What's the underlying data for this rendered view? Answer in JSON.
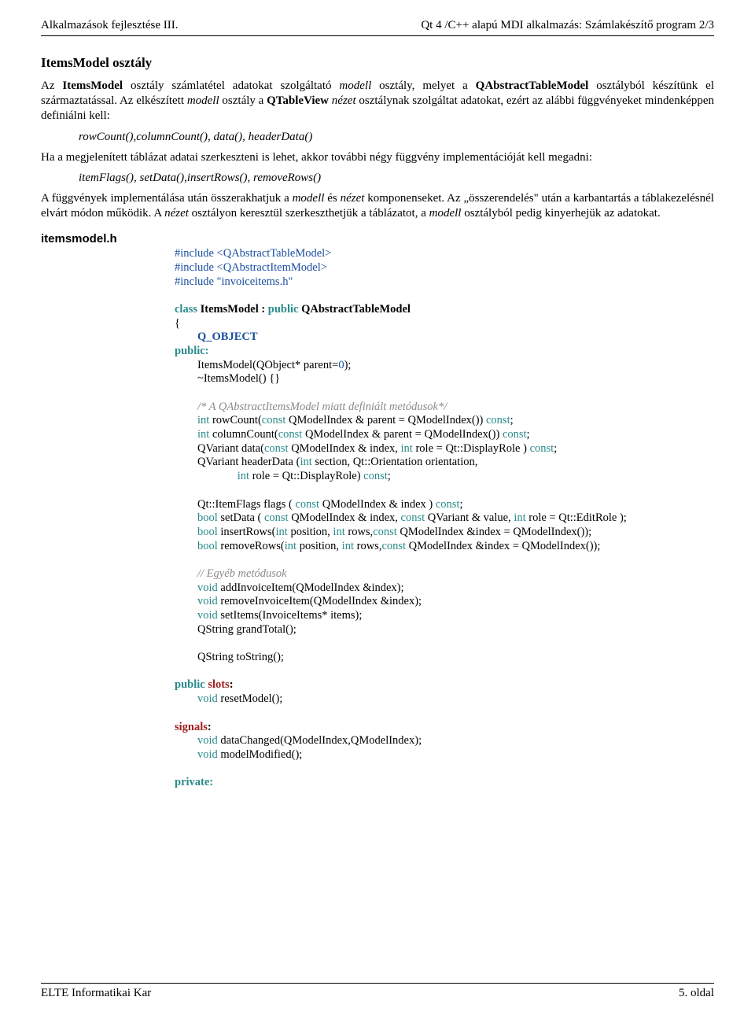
{
  "header": {
    "left": "Alkalmazások fejlesztése III.",
    "right": "Qt 4 /C++ alapú MDI alkalmazás: Számlakészítő program 2/3"
  },
  "section_title": "ItemsModel osztály",
  "para1_a": "Az ",
  "para1_b": "ItemsModel",
  "para1_c": " osztály számlatétel adatokat szolgáltató ",
  "para1_d": "modell",
  "para1_e": " osztály, melyet a ",
  "para1_f": "QAbstractTableModel",
  "para1_g": " osztályból készítünk el származtatással. Az elkészített ",
  "para1_h": "modell",
  "para1_i": " osztály a ",
  "para1_j": "QTableView",
  "para1_k": " ",
  "para1_l": "nézet",
  "para1_m": " osztálynak szolgáltat adatokat, ezért az alábbi függvényeket mindenképpen definiálni kell:",
  "indent1": "rowCount(),columnCount(), data(), headerData()",
  "para2": "Ha a megjelenített táblázat adatai szerkeszteni is lehet, akkor további négy függvény implementációját  kell megadni:",
  "indent2": "itemFlags(), setData(),insertRows(), removeRows()",
  "para3_a": "A függvények implementálása után összerakhatjuk a ",
  "para3_b": "modell",
  "para3_c": " és ",
  "para3_d": "nézet",
  "para3_e": " komponenseket. Az „összerendelés\" után a karbantartás a táblakezelésnél elvárt módon működik. A ",
  "para3_f": "nézet",
  "para3_g": " osztályon keresztül szerkeszthetjük a táblázatot, a ",
  "para3_h": "modell",
  "para3_i": " osztályból pedig kinyerhejük az adatokat.",
  "filename": "itemsmodel.h",
  "code": {
    "l1": "#include <QAbstractTableModel>",
    "l2": "#include <QAbstractItemModel>",
    "l3": "#include \"invoiceitems.h\"",
    "l4a": "class",
    "l4b": " ItemsModel : ",
    "l4c": "public",
    "l4d": " QAbstractTableModel",
    "l5": "{",
    "l6": "Q_OBJECT",
    "l7": "public:",
    "l8a": "ItemsModel(QObject* parent=",
    "l8b": "0",
    "l8c": ");",
    "l9": "~ItemsModel() {}",
    "l10": "/* A QAbstractItemsModel miatt definiált metódusok*/",
    "l11a": "int",
    "l11b": " rowCount(",
    "l11c": "const",
    "l11d": " QModelIndex & parent = QModelIndex()) ",
    "l11e": "const",
    "l11f": ";",
    "l12a": "int",
    "l12b": " columnCount(",
    "l12c": "const",
    "l12d": " QModelIndex & parent = QModelIndex()) ",
    "l12e": "const",
    "l12f": ";",
    "l13a": "QVariant data(",
    "l13b": "const",
    "l13c": " QModelIndex & index, ",
    "l13d": "int",
    "l13e": " role = Qt::DisplayRole ) ",
    "l13f": "const",
    "l13g": ";",
    "l14a": "QVariant headerData (",
    "l14b": "int",
    "l14c": " section, Qt::Orientation orientation,",
    "l15a": "int",
    "l15b": " role = Qt::DisplayRole) ",
    "l15c": "const",
    "l15d": ";",
    "l16a": "Qt::ItemFlags flags ( ",
    "l16b": "const",
    "l16c": " QModelIndex & index ) ",
    "l16d": "const",
    "l16e": ";",
    "l17a": "bool",
    "l17b": " setData ( ",
    "l17c": "const",
    "l17d": " QModelIndex & index, ",
    "l17e": "const",
    "l17f": " QVariant & value, ",
    "l17g": "int",
    "l17h": " role = Qt::EditRole );",
    "l18a": "bool",
    "l18b": " insertRows(",
    "l18c": "int",
    "l18d": " position, ",
    "l18e": "int",
    "l18f": " rows,",
    "l18g": "const",
    "l18h": " QModelIndex &index = QModelIndex());",
    "l19a": "bool",
    "l19b": " removeRows(",
    "l19c": "int",
    "l19d": " position, ",
    "l19e": "int",
    "l19f": " rows,",
    "l19g": "const",
    "l19h": " QModelIndex &index = QModelIndex());",
    "l20": "// Egyéb metódusok",
    "l21a": "void",
    "l21b": " addInvoiceItem(QModelIndex &index);",
    "l22a": "void",
    "l22b": " removeInvoiceItem(QModelIndex &index);",
    "l23a": "void",
    "l23b": " setItems(InvoiceItems* items);",
    "l24": "QString grandTotal();",
    "l25": "QString toString();",
    "l26a": "public",
    "l26b": " slots",
    "l26c": ":",
    "l27a": "void",
    "l27b": " resetModel();",
    "l28a": "signals",
    "l28b": ":",
    "l29a": "void",
    "l29b": " dataChanged(QModelIndex,QModelIndex);",
    "l30a": "void",
    "l30b": " modelModified();",
    "l31": "private:"
  },
  "footer": {
    "left": "ELTE Informatikai Kar",
    "right": "5. oldal"
  }
}
